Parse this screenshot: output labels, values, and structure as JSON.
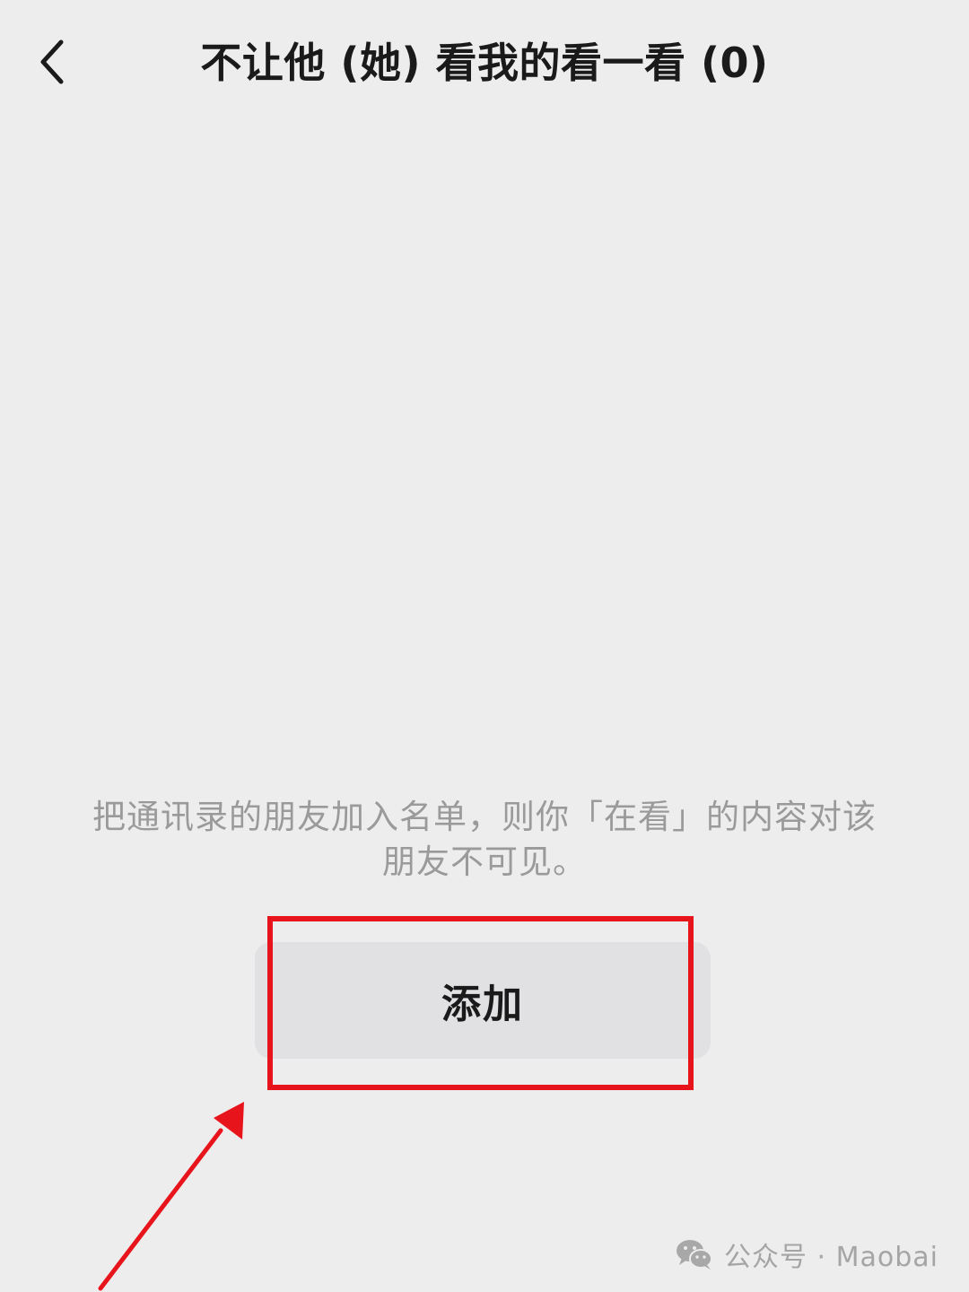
{
  "nav": {
    "title": "不让他 (她) 看我的看一看 (0)",
    "back_icon": "chevron-left-icon"
  },
  "description": {
    "line1": "把通讯录的朋友加入名单，则你「在看」的内容对该",
    "line2": "朋友不可见。"
  },
  "actions": {
    "add_label": "添加"
  },
  "watermark": {
    "icon": "wechat-icon",
    "text": "公众号 · Maobai"
  },
  "colors": {
    "background": "#ededed",
    "button_bg": "#e1e0e3",
    "annotation_red": "#e8141b",
    "text_primary": "#1a1a1a",
    "text_secondary": "#9a9a9a"
  }
}
